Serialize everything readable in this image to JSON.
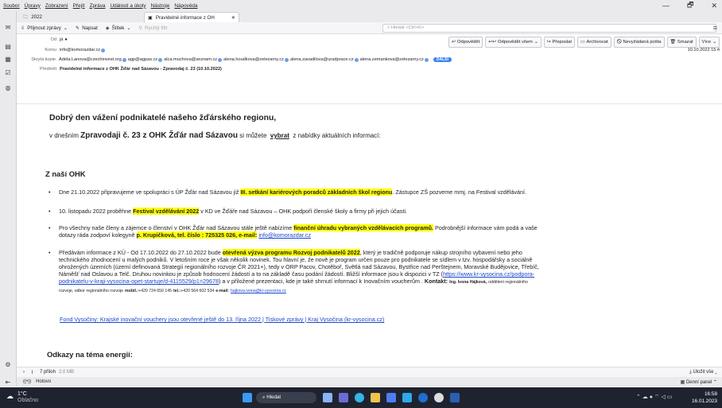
{
  "menu": [
    "Soubor",
    "Úpravy",
    "Zobrazení",
    "Přejít",
    "Zpráva",
    "Události a úkoly",
    "Nástroje",
    "Nápověda"
  ],
  "window_controls": {
    "minimize": "—",
    "maximize": "🗗",
    "close": "✕"
  },
  "tabs": [
    {
      "label": "2022"
    },
    {
      "label": "Pravidelné informace z OH",
      "close": "✕"
    }
  ],
  "toolbar": {
    "get_mail": "Přijmout zprávy",
    "write": "Napsat",
    "tag": "Štítek",
    "quick_filter": "Rychlý filtr",
    "search_placeholder": "Hledat <Ctrl+K>",
    "menu_icon": "≡"
  },
  "header": {
    "from_label": "Od",
    "from_value": "já",
    "to_label": "Komu",
    "to_value": "info@komorazdar.cz",
    "cc_label": "Skrytá kopie",
    "cc_values": [
      "Adela.Lanova@czechinvest.org",
      "agp@agpas.cz",
      "alca.muchova@seznam.cz",
      "alena.houdkova@zelezarny.cz",
      "alena.zavadilova@uradprace.cz",
      "alena.zemankova@zelezarny.cz"
    ],
    "cc_more": "DALŠÍ",
    "subject_label": "Předmět",
    "subject_value": "Pravidelné informace z OHK Žďár nad Sázavou - Zpravodaj č. 23 (10.10.2022)",
    "date": "10.10.2022 15:4",
    "actions": [
      "Odpovědět",
      "Odpovědět všem",
      "Přeposlat",
      "Archivovat",
      "Nevyžádaná pošta",
      "Smazat",
      "Více"
    ]
  },
  "body": {
    "greeting": "Dobrý den vážení podnikatelé našeho žďárského regionu,",
    "intro_pre": "v dnešním",
    "intro_bold": "Zpravodaji č. 23  z  OHK Žďár nad Sázavou",
    "intro_mid": "si můžete",
    "intro_link": "vybrat",
    "intro_post": "z nabídky aktuálních informací:",
    "section1": "Z naší OHK",
    "b1_pre": "Dne 21.10.2022 připravujeme ve spolupráci s ÚP Žďár nad Sázavou již",
    "b1_hl": "III. setkání kariérových poradců základních škol regionu",
    "b1_post": ". Zástupce ZŠ pozveme mmj. na Festival vzdělávání.",
    "b2_pre": "10. listopadu 2022 proběhne",
    "b2_hl": "Festival vzdělávání 2022",
    "b2_post": "v KD ve Žďáře nad Sázavou – OHK podpoří členské školy a firmy při jejich účasti.",
    "b3_pre": "Pro všechny naše členy a zájemce o členství v OHK Žďár nad Sázavou stále ještě nabízíme",
    "b3_hl": "finanční úhradu vybraných vzdělávacích programů.",
    "b3_mid": " Podrobnější informace  vám podá a vaše",
    "b3_line2": "dotazy ráda zodpoví kolegyně",
    "b3_hl2": "p. Krupičková, tel. číslo : 725325 026, e-mail:",
    "b3_email": "info@komorazdar.cz",
    "b4_pre": "Předávám informace z KÚ - Od 17.10.2022 do 27.10.2022 bude",
    "b4_hl": "otevřená výzva programu Rozvoj podnikatelů 2022",
    "b4_post": ", který je tradičně podporuje nákup strojního vybavení nebo jeho",
    "b4_l2": "technického zhodnocení u malých podniků. V letošním roce je však několik novinek. Tou hlavní je, že nově je program určen pouze pro podnikatele se sídlem v tzv. hospodářsky a sociálně",
    "b4_l3": "ohrožených územích (území definovaná Strategií regionálního rozvoje ČR 2021+), tedy v ORP Pacov, Chotěboř, Světlá nad Sázavou, Bystřice nad Perštejnem, Moravské Budějovice, Třebíč,",
    "b4_l4": "Náměšť nad Oslavou a Telč. Druhou novinkou je způsob hodnocení žádostí a to na základě času podání žádostí. Bližší informace jsou k dispozici v TZ (",
    "b4_link1": "https://www.kr-vysocina.cz/podpora-",
    "b4_link2": "podnikatelu-v-kraji-vysocina-opet-startuje/d-4115529/p1=29678",
    "b4_l5": ") a v přiložené prezentaci, kde je také shrnutí informací k Inovačním voucherům .",
    "b4_contact": "Kontakt:",
    "b4_contact_name": "Ing. Ivona Hájková,",
    "b4_contact_role": "oddělení regionálního",
    "b4_l6": "rozvoje, odbor regionálního rozvoje",
    "b4_mobile_label": "mobil.:",
    "b4_mobile": "+420 724 650 145",
    "b4_tel_label": "tel.:",
    "b4_tel": "+420 564 602 534",
    "b4_email_label": "e-mail:",
    "b4_email": "hajkova.ivona@kr-vysocina.cz",
    "link_vysocina": "Fond Vysočiny: Krajské inovační vouchery jsou otevřené ještě do 13. října 2022 | Tiskové zprávy | Kraj Vysočina (kr-vysocina.cz)",
    "section2": "Odkazy na téma energií:"
  },
  "attachments": {
    "count": "7 příloh",
    "size": "2,0 MB",
    "save_all": "Uložit vše"
  },
  "status": {
    "text": "Hotovo",
    "panel": "Denní panel"
  },
  "taskbar": {
    "temp": "1°C",
    "weather": "Oblačno",
    "search": "Hledat",
    "time": "16:58",
    "date": "16.01.2023"
  }
}
